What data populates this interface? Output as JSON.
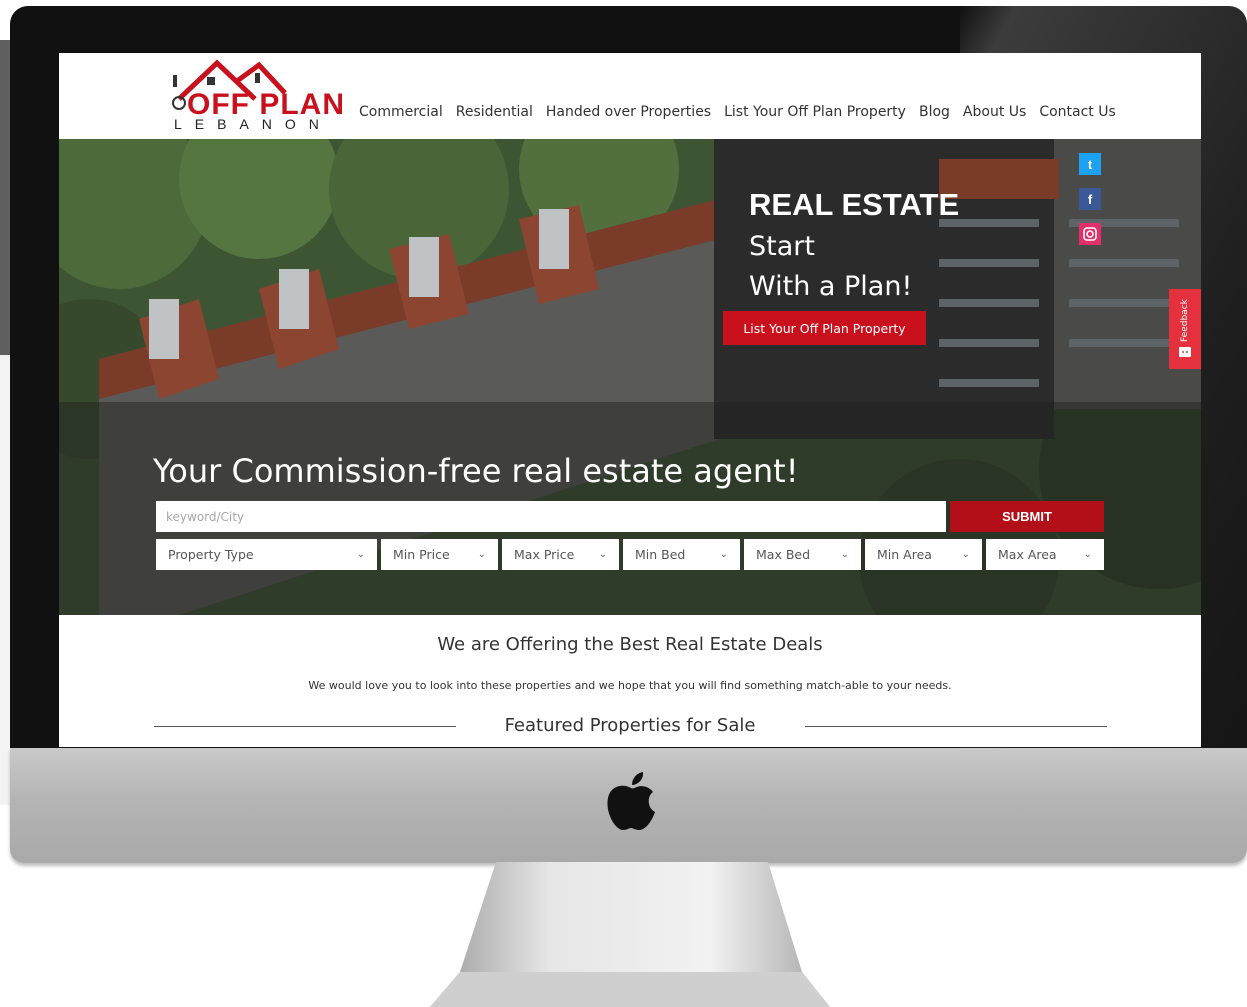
{
  "header": {
    "logo_main": "OFF PLAN",
    "logo_sub": "LEBANON"
  },
  "nav": {
    "items": [
      "Commercial",
      "Residential",
      "Handed over Properties",
      "List Your Off Plan Property",
      "Blog",
      "About Us",
      "Contact Us"
    ]
  },
  "hero": {
    "title": "REAL ESTATE",
    "subtitle_line1": "Start",
    "subtitle_line2": "With a Plan!",
    "cta_label": "List Your Off Plan Property",
    "social": [
      "twitter-icon",
      "facebook-icon",
      "instagram-icon"
    ],
    "feedback_label": "Feedback"
  },
  "search": {
    "heading": "Your Commission-free real estate agent!",
    "placeholder": "keyword/City",
    "submit_label": "SUBMIT",
    "filters": [
      "Property Type",
      "Min Price",
      "Max Price",
      "Min Bed",
      "Max Bed",
      "Min Area",
      "Max Area"
    ]
  },
  "offers": {
    "title": "We are Offering the Best Real Estate Deals",
    "text": "We would love you to look into these properties and we hope that you will find something match-able to your needs.",
    "featured_title": "Featured Properties for Sale"
  },
  "colors": {
    "brand_red": "#c8111d",
    "twitter": "#1da1f2",
    "facebook": "#3b5998",
    "instagram": "#e1306c",
    "feedback": "#e5303d"
  }
}
